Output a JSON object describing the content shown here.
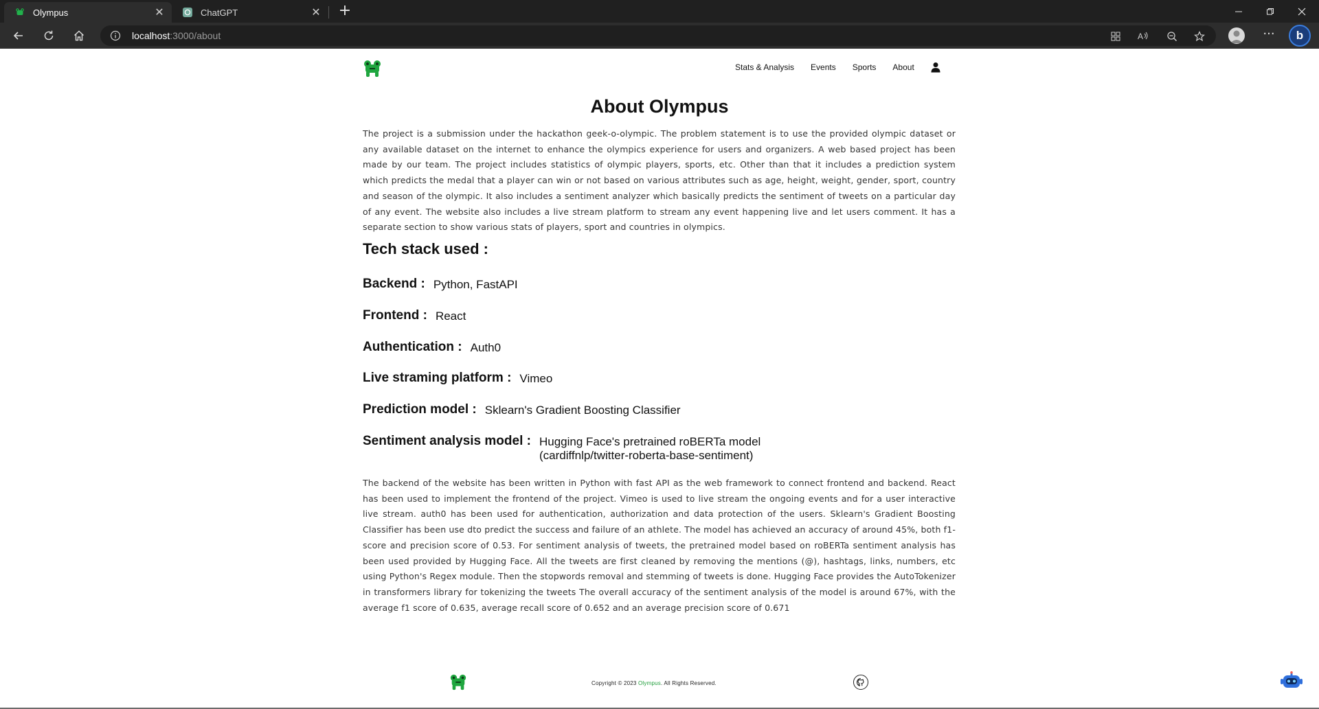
{
  "browser": {
    "tabs": [
      {
        "title": "Olympus",
        "active": true
      },
      {
        "title": "ChatGPT",
        "active": false
      }
    ],
    "url_host": "localhost",
    "url_path": ":3000/about",
    "new_tab_icon": "plus-icon"
  },
  "site": {
    "nav": {
      "links": [
        "Stats & Analysis",
        "Events",
        "Sports",
        "About"
      ],
      "user_icon": "user-icon",
      "logo_icon": "olympus-frog-logo"
    },
    "title": "About Olympus",
    "intro": "The project is a submission under the hackathon geek-o-olympic. The problem statement is to use the provided olympic dataset or any available dataset on the internet to enhance the olympics experience for users and organizers. A web based project has been made by our team. The project includes statistics of olympic players, sports, etc. Other than that it includes a prediction system which predicts the medal that a player can win or not based on various attributes such as age, height, weight, gender, sport, country and season of the olympic. It also includes a sentiment analyzer which basically predicts the sentiment of tweets on a particular day of any event. The website also includes a live stream platform to stream any event happening live and let users comment. It has a separate section to show various stats of players, sport and countries in olympics.",
    "tech_stack_title": "Tech stack used :",
    "tech_stack": [
      {
        "label": "Backend :",
        "value": "Python, FastAPI"
      },
      {
        "label": "Frontend :",
        "value": "React"
      },
      {
        "label": "Authentication :",
        "value": "Auth0"
      },
      {
        "label": "Live straming platform :",
        "value": "Vimeo"
      },
      {
        "label": "Prediction model :",
        "value": "Sklearn's Gradient Boosting Classifier"
      },
      {
        "label": "Sentiment analysis model :",
        "value": "Hugging Face's pretrained roBERTa model",
        "value2": "(cardiffnlp/twitter-roberta-base-sentiment)"
      }
    ],
    "details": "The backend of the website has been written in Python with fast API as the web framework to connect frontend and backend. React has been used to implement the frontend of the project. Vimeo is used to live stream the ongoing events and for a user interactive live stream. auth0 has been used for authentication, authorization and data protection of the users. Sklearn's Gradient Boosting Classifier has been use dto predict the success and failure of an athlete. The model has achieved an accuracy of around 45%, both f1-score and precision score of 0.53. For sentiment analysis of tweets, the pretrained model based on roBERTa sentiment analysis has been used provided by Hugging Face. All the tweets are first cleaned by removing the mentions (@), hashtags, links, numbers, etc using Python's Regex module. Then the stopwords removal and stemming of tweets is done. Hugging Face provides the AutoTokenizer in transformers library for tokenizing the tweets The overall accuracy of the sentiment analysis of the model is around 67%, with the average f1 score of 0.635, average recall score of 0.652 and an average precision score of 0.671",
    "footer": {
      "copyright_prefix": "Copyright © 2023 ",
      "brand": "Olympus",
      "copyright_suffix": ". All Rights Reserved.",
      "github_icon": "github-icon",
      "chatbot_icon": "chatbot-icon"
    }
  },
  "colors": {
    "brand_green": "#1f9d3a",
    "chrome_dark": "#202020",
    "chrome_toolbar": "#2d2d2d"
  }
}
